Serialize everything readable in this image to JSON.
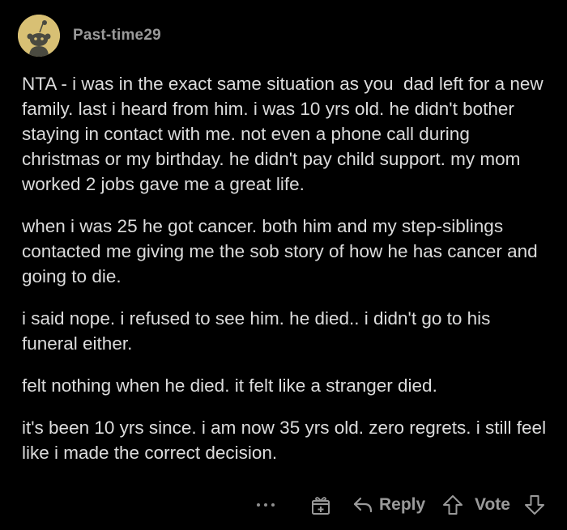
{
  "comment": {
    "username": "Past-time29",
    "paragraphs": [
      "NTA - i was in the exact same situation as you  dad left for a new family. last i heard from him. i was 10 yrs old. he didn't bother staying in contact with me. not even a phone call during christmas or my birthday. he didn't pay child support. my mom worked 2 jobs gave me a great life.",
      "when i was 25 he got cancer. both him and my step-siblings contacted me giving me the sob story of how he has cancer and going to die.",
      "i said nope. i refused to see him. he died.. i didn't go to his funeral either.",
      "felt nothing when he died. it felt like a stranger died.",
      "it's been 10 yrs since. i am now 35 yrs old. zero regrets. i still feel like i made the correct decision."
    ]
  },
  "actions": {
    "more_icon": "more-dots-icon",
    "award_icon": "gift-award-icon",
    "reply_icon": "reply-arrow-icon",
    "reply_label": "Reply",
    "upvote_icon": "upvote-arrow-icon",
    "vote_label": "Vote",
    "downvote_icon": "downvote-arrow-icon"
  },
  "colors": {
    "background": "#000000",
    "text": "#dcdcdc",
    "muted": "#9a9a9a",
    "avatar": "#d8c074"
  }
}
